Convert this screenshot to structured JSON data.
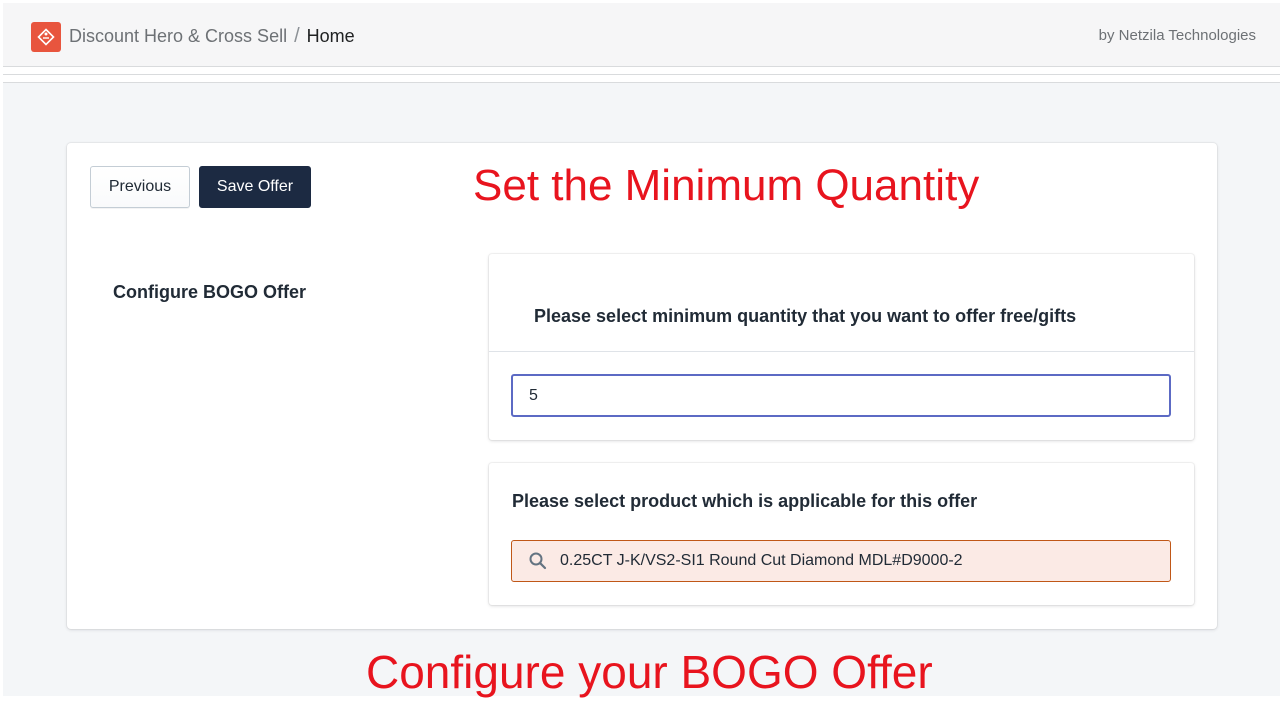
{
  "header": {
    "app_name": "Discount Hero & Cross Sell",
    "separator": "/",
    "current_page": "Home",
    "byline": "by Netzila Technologies",
    "app_icon": "tag-icon",
    "brand_color": "#e8553e"
  },
  "toolbar": {
    "previous_label": "Previous",
    "save_label": "Save Offer",
    "save_color": "#1c2a42"
  },
  "annotations": {
    "top": "Set the Minimum Quantity",
    "bottom": "Configure your BOGO Offer",
    "color": "#e8141e"
  },
  "section": {
    "title": "Configure BOGO Offer"
  },
  "quantity_card": {
    "label": "Please select minimum quantity that you want to offer free/gifts",
    "value": "5",
    "focus_color": "#5c6ac4"
  },
  "product_card": {
    "label": "Please select product which is applicable for this offer",
    "search_icon": "search-icon",
    "selected_product": "0.25CT J-K/VS2-SI1 Round Cut Diamond MDL#D9000-2",
    "field_color": "#fbeae5"
  }
}
